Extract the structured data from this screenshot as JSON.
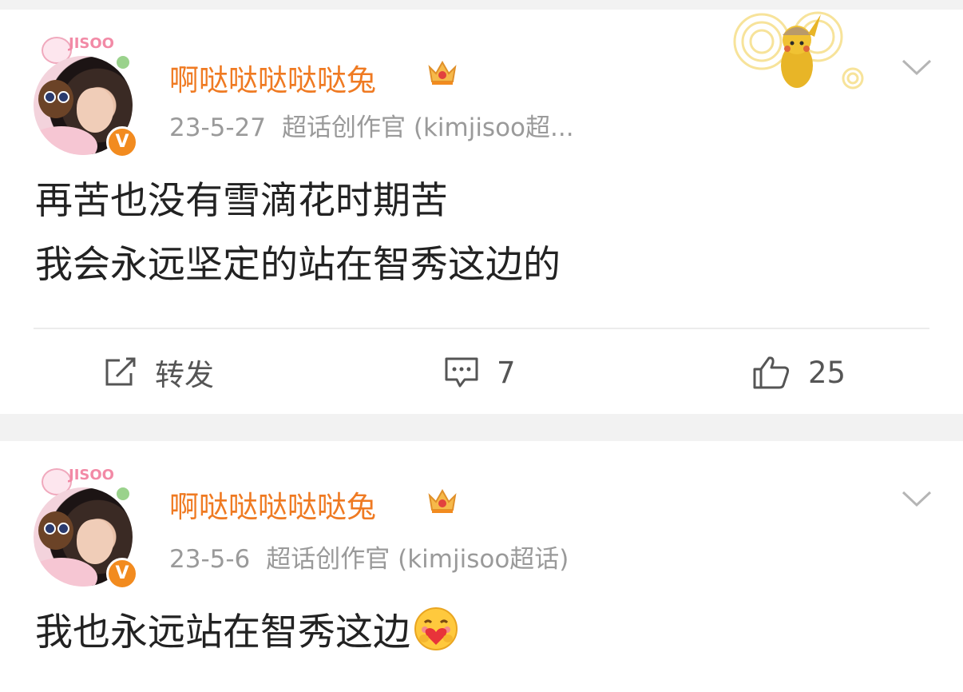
{
  "posts": [
    {
      "username": "啊哒哒哒哒哒兔",
      "time": "23-5-27",
      "source": "超话创作官 (kimjisoo超...",
      "avatar_tag": "JISOO",
      "text_lines": [
        "再苦也没有雪滴花时期苦",
        "我会永远坚定的站在智秀这边的"
      ],
      "actions": {
        "repost_label": "转发",
        "comment_count": "7",
        "like_count": "25"
      },
      "icons": [
        "crown-icon",
        "chevron-down-icon",
        "repost-icon",
        "comment-icon",
        "like-icon",
        "verified-v-icon"
      ]
    },
    {
      "username": "啊哒哒哒哒哒兔",
      "time": "23-5-6",
      "source": "超话创作官 (kimjisoo超话)",
      "avatar_tag": "JISOO",
      "text_lines": [
        "我也永远站在智秀这边"
      ],
      "emoji": "hugging-heart-emoji",
      "icons": [
        "crown-icon",
        "chevron-down-icon",
        "verified-v-icon"
      ]
    }
  ],
  "verified_badge": "V",
  "colors": {
    "accent": "#ef7a22",
    "meta_gray": "#9a9a9a",
    "text": "#222222",
    "background": "#f2f2f2",
    "card": "#ffffff",
    "verified_orange": "#f28b1f"
  }
}
